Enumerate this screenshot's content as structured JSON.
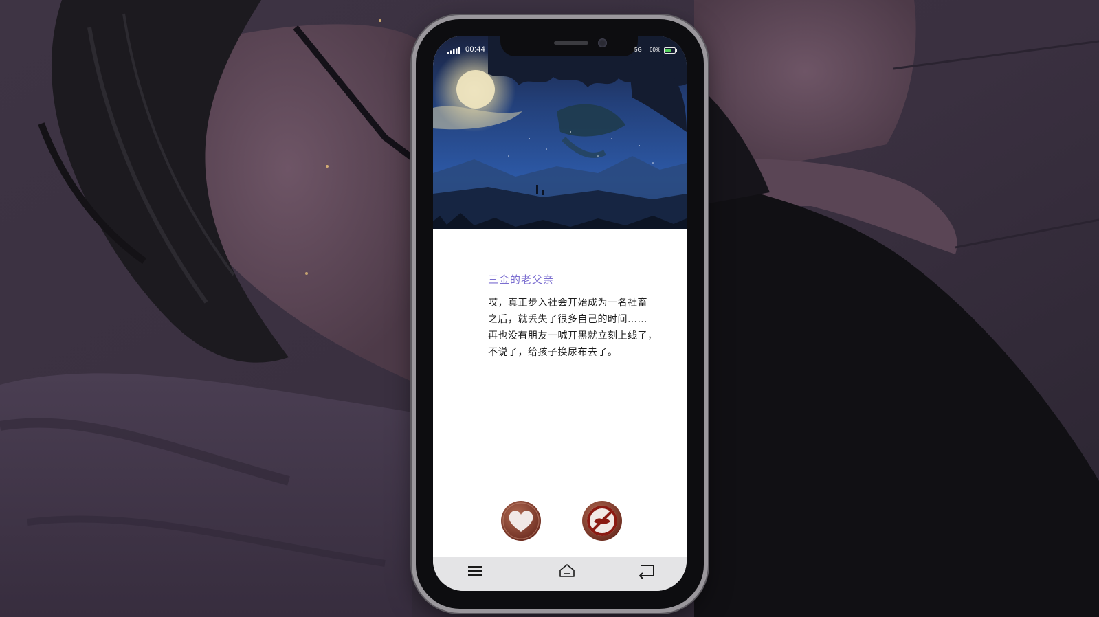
{
  "status_bar": {
    "time": "00:44",
    "network": "5G",
    "battery_text": "60%",
    "battery_level": 0.6,
    "battery_color": "#52d05a"
  },
  "post": {
    "author": "三金的老父亲",
    "author_color": "#7b6ed0",
    "body_lines": [
      "哎，真正步入社会开始成为一名社畜",
      "之后，就丢失了很多自己的时间……",
      "再也没有朋友一喊开黑就立刻上线了，",
      "不说了，给孩子换尿布去了。"
    ]
  },
  "reactions": {
    "like_icon": "heart-icon",
    "dislike_icon": "no-kiss-icon",
    "button_color": "#8a3a2a"
  },
  "nav_bar": {
    "menu_icon": "menu-icon",
    "home_icon": "home-icon",
    "back_icon": "back-icon"
  }
}
